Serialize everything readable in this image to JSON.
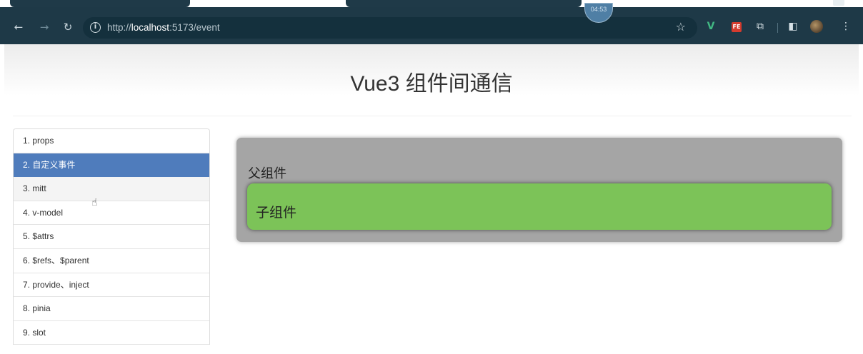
{
  "browser": {
    "url_prefix": "http://",
    "url_host": "localhost",
    "url_rest": ":5173/event",
    "timer": "04:53",
    "extensions": {
      "vue_label": "V",
      "fe_label": "FE"
    }
  },
  "page": {
    "title": "Vue3 组件间通信"
  },
  "nav": {
    "items": [
      {
        "label": "1. props"
      },
      {
        "label": "2. 自定义事件"
      },
      {
        "label": "3. mitt"
      },
      {
        "label": "4. v-model"
      },
      {
        "label": "5. $attrs"
      },
      {
        "label": "6. $refs、$parent"
      },
      {
        "label": "7. provide、inject"
      },
      {
        "label": "8. pinia"
      },
      {
        "label": "9. slot"
      }
    ],
    "active_index": 1
  },
  "father": {
    "title": "父组件",
    "child": {
      "title": "子组件"
    }
  },
  "colors": {
    "toolbar": "#1e3947",
    "nav_active": "#4f7cbc",
    "father_bg": "#a5a5a5",
    "child_bg": "#7cc358"
  }
}
